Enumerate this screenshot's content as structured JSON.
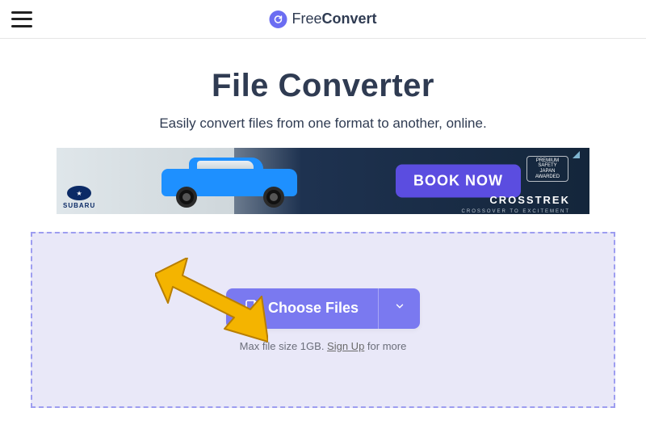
{
  "header": {
    "logo_free": "Free",
    "logo_convert": "Convert"
  },
  "hero": {
    "title": "File Converter",
    "subtitle": "Easily convert files from one format to another, online."
  },
  "ad": {
    "book_label": "BOOK NOW",
    "brand": "CROSSTREK",
    "subaru_label": "SUBARU",
    "badge_l1": "PREMIUM",
    "badge_l2": "SAFETY",
    "badge_l3": "JAPAN",
    "badge_l4": "AWARDED",
    "sub": "CROSSOVER  TO  EXCITEMENT"
  },
  "dropzone": {
    "choose_label": "Choose Files",
    "max_prefix": "Max file size 1GB. ",
    "signup": "Sign Up",
    "max_suffix": " for more"
  }
}
